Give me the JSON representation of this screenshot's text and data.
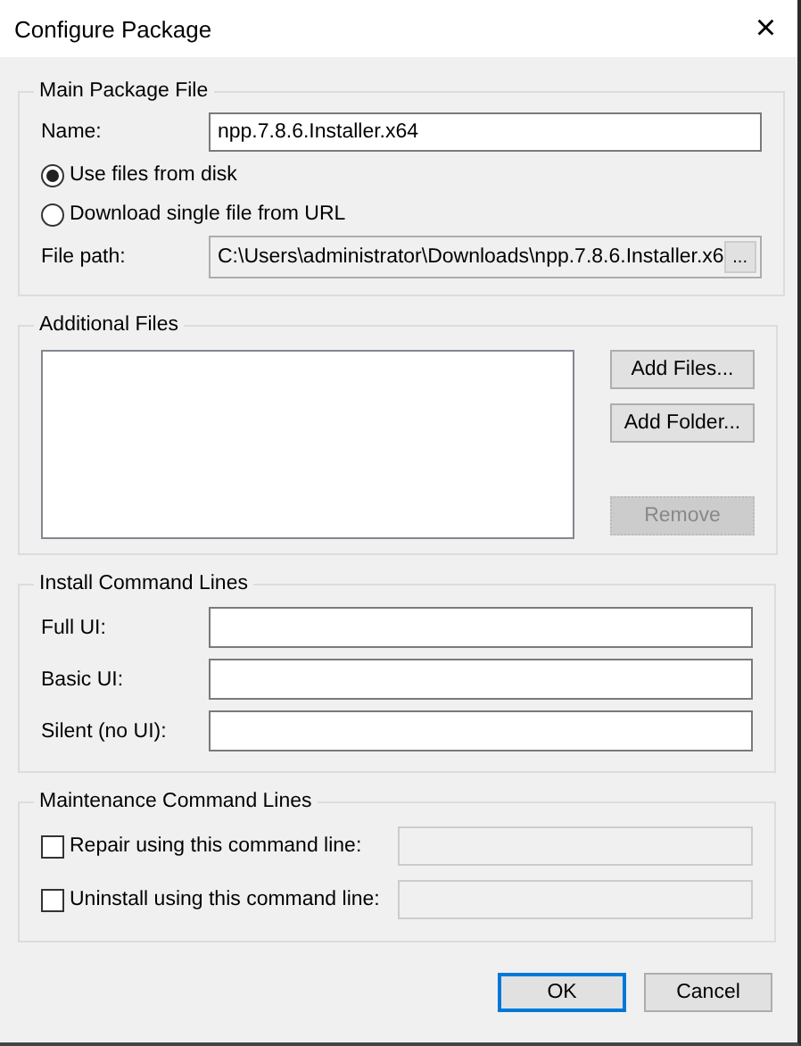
{
  "window": {
    "title": "Configure Package",
    "close": "×"
  },
  "main_package": {
    "title": "Main Package File",
    "name_label": "Name:",
    "name_value": "npp.7.8.6.Installer.x64",
    "sources": [
      {
        "label": "Use files from disk",
        "selected": true
      },
      {
        "label": "Download single file from URL",
        "selected": false
      }
    ],
    "file_path_label": "File path:",
    "file_path_value": "C:\\Users\\administrator\\Downloads\\npp.7.8.6.Installer.x6",
    "file_path_disabled": true,
    "browse": "..."
  },
  "additional_files": {
    "title": "Additional Files",
    "buttons": [
      {
        "label": "Add Files...",
        "disabled": false
      },
      {
        "label": "Add Folder...",
        "disabled": false
      },
      {
        "label": "Remove",
        "disabled": true
      }
    ]
  },
  "install_command_lines": {
    "title": "Install Command Lines",
    "fields": [
      {
        "label": "Full UI:"
      },
      {
        "label": "Basic UI:"
      },
      {
        "label": "Silent (no UI):"
      }
    ]
  },
  "maintenance_command_lines": {
    "title": "Maintenance Command Lines",
    "rows": [
      {
        "label": "Repair using this command line:",
        "checked": false,
        "disabled": true
      },
      {
        "label": "Uninstall using this command line:",
        "checked": false,
        "disabled": true
      }
    ]
  },
  "buttons": [
    {
      "label": "OK",
      "default": true
    },
    {
      "label": "Cancel",
      "default": false
    }
  ]
}
